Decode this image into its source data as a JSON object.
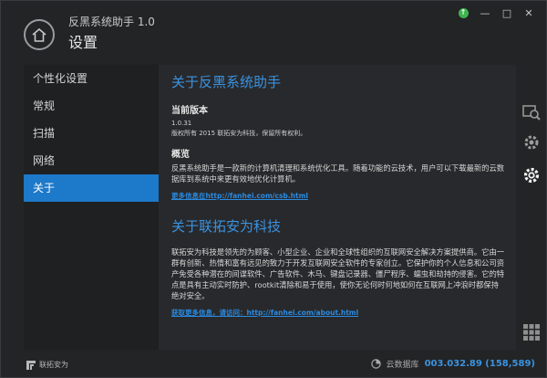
{
  "header": {
    "app_title": "反黑系统助手 1.0",
    "page_title": "设置"
  },
  "window_controls": {
    "minimize": "—",
    "maximize": "□",
    "close": "✕"
  },
  "sidebar": {
    "items": [
      {
        "label": "个性化设置",
        "active": false
      },
      {
        "label": "常规",
        "active": false
      },
      {
        "label": "扫描",
        "active": false
      },
      {
        "label": "网络",
        "active": false
      },
      {
        "label": "关于",
        "active": true
      }
    ]
  },
  "about_app": {
    "title": "关于反黑系统助手",
    "version_heading": "当前版本",
    "version": "1.0.31",
    "copyright": "版权所有 2015 联拓安为科技，保留所有权利。",
    "overview_heading": "概览",
    "overview_text": "反黑系统助手是一款新的计算机清理和系统优化工具。随着功能的云技术，用户可以下载最新的云数据库到系统中来更有效地优化计算机。",
    "link": "更多信息在http://fanhei.com/csb.html"
  },
  "about_company": {
    "title": "关于联拓安为科技",
    "text": "联拓安为科技是领先的为顾客、小型企业、企业和全球性组织的互联网安全解决方案提供商。它由一群有创新、热情和富有远见的致力于开发互联网安全软件的专家创立。它保护你的个人信息和公司资产免受各种潜在的间谍软件、广告软件、木马、键盘记录器、僵尸程序、蠕虫和劫持的侵害。它的特点是具有主动实时防护、rootkit清除和易于使用，使你无论何时何地如何在互联网上冲浪时都保持绝对安全。",
    "link": "获取更多信息，请访问：http://fanhei.com/about.html"
  },
  "footer": {
    "brand": "联拓安为",
    "db_label": "云数据库",
    "db_value": "003.032.89 (158,589)"
  },
  "colors": {
    "accent": "#1d79c9",
    "heading_blue": "#3a93e0",
    "update_green": "#3fb34f"
  }
}
